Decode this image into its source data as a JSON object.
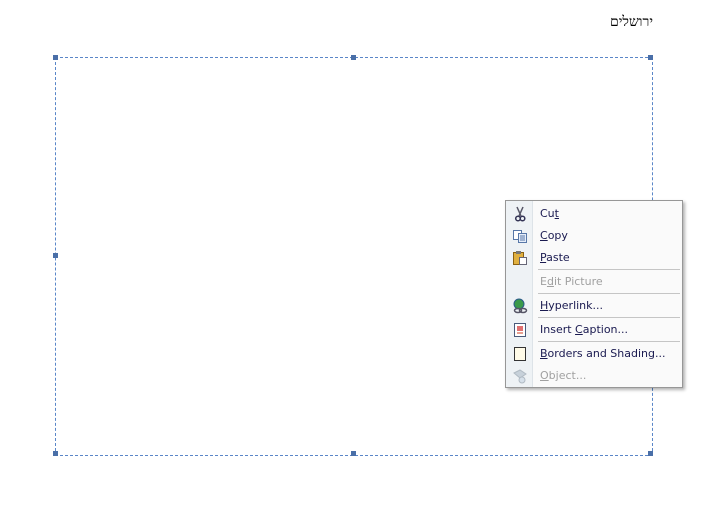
{
  "document": {
    "heading_text": "ירושלים"
  },
  "context_menu": {
    "items": [
      {
        "pre": "Cu",
        "key": "t",
        "post": "",
        "icon": "scissors-icon",
        "enabled": true
      },
      {
        "pre": "",
        "key": "C",
        "post": "opy",
        "icon": "copy-icon",
        "enabled": true
      },
      {
        "pre": "",
        "key": "P",
        "post": "aste",
        "icon": "paste-icon",
        "enabled": true
      },
      {
        "pre": "E",
        "key": "d",
        "post": "it Picture",
        "icon": "",
        "enabled": false
      },
      {
        "pre": "",
        "key": "H",
        "post": "yperlink...",
        "icon": "hyperlink-globe-icon",
        "enabled": true
      },
      {
        "pre": "Insert ",
        "key": "C",
        "post": "aption...",
        "icon": "caption-icon",
        "enabled": true
      },
      {
        "pre": "",
        "key": "B",
        "post": "orders and Shading...",
        "icon": "page-border-icon",
        "enabled": true
      },
      {
        "pre": "",
        "key": "O",
        "post": "bject...",
        "icon": "object-icon",
        "enabled": false
      }
    ]
  }
}
